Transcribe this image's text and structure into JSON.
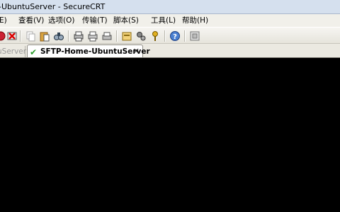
{
  "window": {
    "title": "-UbuntuServer - SecureCRT"
  },
  "menu": {
    "items": [
      {
        "label": "E)"
      },
      {
        "label": "查看(V)"
      },
      {
        "label": "选项(O)"
      },
      {
        "label": "传输(T)"
      },
      {
        "label": "脚本(S)"
      },
      {
        "label": "工具(L)"
      },
      {
        "label": "帮助(H)"
      }
    ]
  },
  "toolbar": {
    "icons": [
      "connect-icon",
      "disconnect-icon",
      "copy-icon",
      "paste-icon",
      "find-icon",
      "print-setup-icon",
      "print-icon",
      "print-selection-icon",
      "session-options-icon",
      "global-options-icon",
      "keymap-icon",
      "help-icon",
      "extra-icon"
    ]
  },
  "tabs": {
    "inactive_label": "uServer",
    "active_label": "SFTP-Home-UbuntuServer",
    "close_symbol": "✕"
  },
  "colors": {
    "terminal_bg": "#000000",
    "connected_check": "#2a9d2a"
  }
}
